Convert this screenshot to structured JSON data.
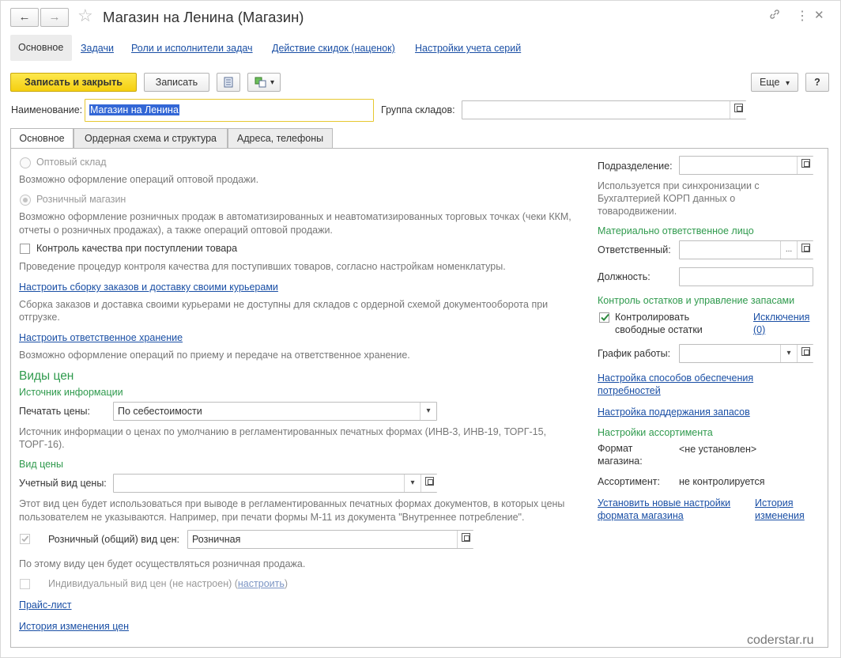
{
  "window": {
    "title": "Магазин на Ленина (Магазин)",
    "back_icon": "←",
    "forward_icon": "→",
    "star_icon": "☆",
    "link_icon": "🔗",
    "more_icon": "⋮",
    "close_icon": "✕"
  },
  "nav_tabs": [
    "Основное",
    "Задачи",
    "Роли и исполнители задач",
    "Действие скидок (наценок)",
    "Настройки учета серий"
  ],
  "toolbar": {
    "save_close": "Записать и закрыть",
    "save": "Записать",
    "more": "Еще",
    "more_arrow": "▾",
    "help": "?"
  },
  "header": {
    "name_label": "Наименование:",
    "name_value": "Магазин на Ленина",
    "group_label": "Группа складов:",
    "group_value": ""
  },
  "form_tabs": [
    "Основное",
    "Ордерная схема и структура",
    "Адреса, телефоны"
  ],
  "left": {
    "wholesale_label": "Оптовый склад",
    "wholesale_desc": "Возможно оформление операций оптовой продажи.",
    "retail_label": "Розничный магазин",
    "retail_desc_1": "Возможно оформление розничных продаж в автоматизированных и неавтоматизированных торговых точках (чеки ККМ,",
    "retail_desc_2": "отчеты о розничных продажах), а также операций оптовой продажи.",
    "quality_label": "Контроль качества при поступлении товара",
    "quality_desc": "Проведение процедур контроля качества для поступивших товаров, согласно настройкам номенклатуры.",
    "courier_link": "Настроить сборку заказов и доставку своими курьерами",
    "courier_desc_1": "Сборка заказов и доставка своими курьерами не доступны для складов с ордерной схемой документооборота при",
    "courier_desc_2": "отгрузке.",
    "storage_link": "Настроить ответственное хранение",
    "storage_desc": "Возможно оформление операций по приему и передаче на ответственное хранение.",
    "prices_header": "Виды цен",
    "source_header": "Источник информации",
    "print_prices_label": "Печатать цены:",
    "print_prices_value": "По себестоимости",
    "print_prices_desc_1": "Источник информации о ценах по умолчанию в регламентированных печатных формах (ИНВ-3, ИНВ-19, ТОРГ-15,",
    "print_prices_desc_2": "ТОРГ-16).",
    "price_type_header": "Вид цены",
    "accounting_price_label": "Учетный вид цены:",
    "accounting_price_value": "",
    "accounting_desc_1": "Этот вид цен будет использоваться при выводе в регламентированных печатных формах документов, в которых цены",
    "accounting_desc_2": "пользователем не указываются. Например, при печати формы М-11 из документа \"Внутреннее потребление\".",
    "retail_price_label": "Розничный (общий) вид цен:",
    "retail_price_value": "Розничная",
    "retail_price_desc": "По этому виду цен будет осуществляться розничная продажа.",
    "individual_label": "Индивидуальный вид цен (не настроен) (",
    "individual_link": "настроить",
    "individual_close": ")",
    "pricelist_link": "Прайс-лист",
    "price_history_link": "История изменения цен"
  },
  "right": {
    "division_label": "Подразделение:",
    "division_value": "",
    "division_desc_1": "Используется при синхронизации с",
    "division_desc_2": "Бухгалтерией КОРП данных о",
    "division_desc_3": "товародвижении.",
    "responsible_header": "Материально ответственное лицо",
    "responsible_label": "Ответственный:",
    "responsible_value": "",
    "position_label": "Должность:",
    "position_value": "",
    "stock_header": "Контроль остатков и управление запасами",
    "control_label_1": "Контролировать",
    "control_label_2": "свободные остатки",
    "exceptions_link_1": "Исключения",
    "exceptions_link_2": "(0)",
    "schedule_label": "График работы:",
    "schedule_value": "",
    "supply_link_1": "Настройка способов обеспечения",
    "supply_link_2": "потребностей",
    "stock_link": "Настройка поддержания запасов",
    "assortment_header": "Настройки ассортимента",
    "format_label_1": "Формат",
    "format_label_2": "магазина:",
    "format_value": "<не установлен>",
    "assortment_label": "Ассортимент:",
    "assortment_value": "не контролируется",
    "new_settings_link_1": "Установить новые настройки",
    "new_settings_link_2": "формата магазина",
    "history_link_1": "История",
    "history_link_2": "изменения"
  },
  "watermark": "coderstar.ru",
  "colors": {
    "accent_green": "#2f9a4d",
    "link_blue": "#1a4fa5",
    "primary_yellow": "#f5cf10"
  }
}
